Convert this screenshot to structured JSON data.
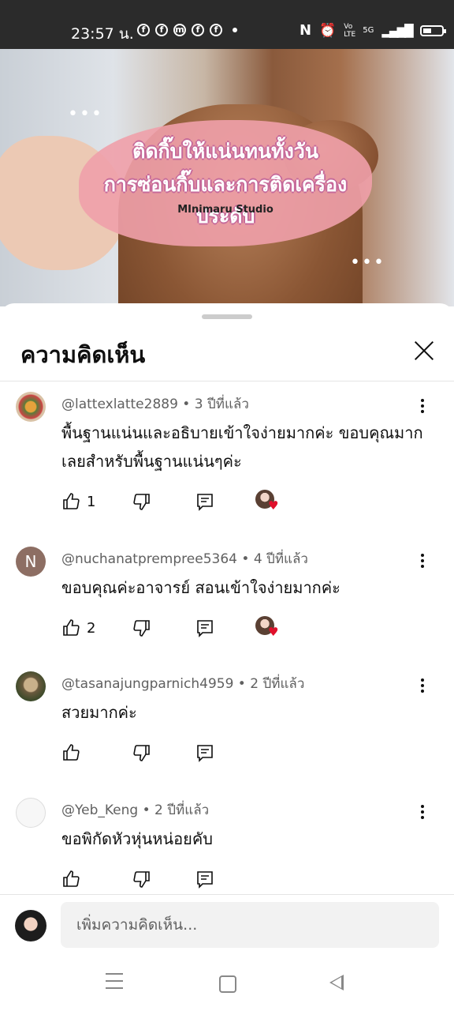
{
  "status_bar": {
    "time": "23:57 น.",
    "network": "5G",
    "volte": "Vo LTE",
    "icons": [
      "facebook-icon",
      "facebook-icon",
      "messenger-icon",
      "facebook-icon",
      "facebook-icon",
      "nfc-icon",
      "alarm-icon",
      "volte-icon",
      "signal-icon",
      "battery-icon"
    ]
  },
  "video": {
    "title_line1": "ติดกิ๊บให้แน่นทนทั้งวัน",
    "title_line2": "การซ่อนกิ๊บและการติดเครื่องประดับ",
    "studio": "MInimaru Studio",
    "label_color": "#f0a0aa"
  },
  "sheet": {
    "title": "ความคิดเห็น"
  },
  "comments": [
    {
      "author": "@lattexlatte2889",
      "age": "3 ปีที่แล้ว",
      "text": "พื้นฐานแน่นและอธิบายเข้าใจง่ายมากค่ะ ขอบคุณมากเลยสำหรับพื้นฐานแน่นๆค่ะ",
      "likes": "1",
      "creator_heart": true,
      "avatar_type": "image"
    },
    {
      "author": "@nuchanatprempree5364",
      "age": "4 ปีที่แล้ว",
      "text": "ขอบคุณค่ะอาจารย์ สอนเข้าใจง่ายมากค่ะ",
      "likes": "2",
      "creator_heart": true,
      "avatar_type": "letter",
      "avatar_letter": "N",
      "avatar_color": "#8d6e63"
    },
    {
      "author": "@tasanajungparnich4959",
      "age": "2 ปีที่แล้ว",
      "text": "สวยมากค่ะ",
      "likes": "",
      "creator_heart": false,
      "avatar_type": "image"
    },
    {
      "author": "@Yeb_Keng",
      "age": "2 ปีที่แล้ว",
      "text": "ขอพิกัดหัวหุ่นหน่อยคับ",
      "likes": "",
      "creator_heart": false,
      "avatar_type": "image"
    }
  ],
  "composer": {
    "placeholder": "เพิ่มความคิดเห็น..."
  },
  "colors": {
    "heart": "#e0102b",
    "text_secondary": "#606060",
    "input_bg": "#f2f2f2"
  }
}
